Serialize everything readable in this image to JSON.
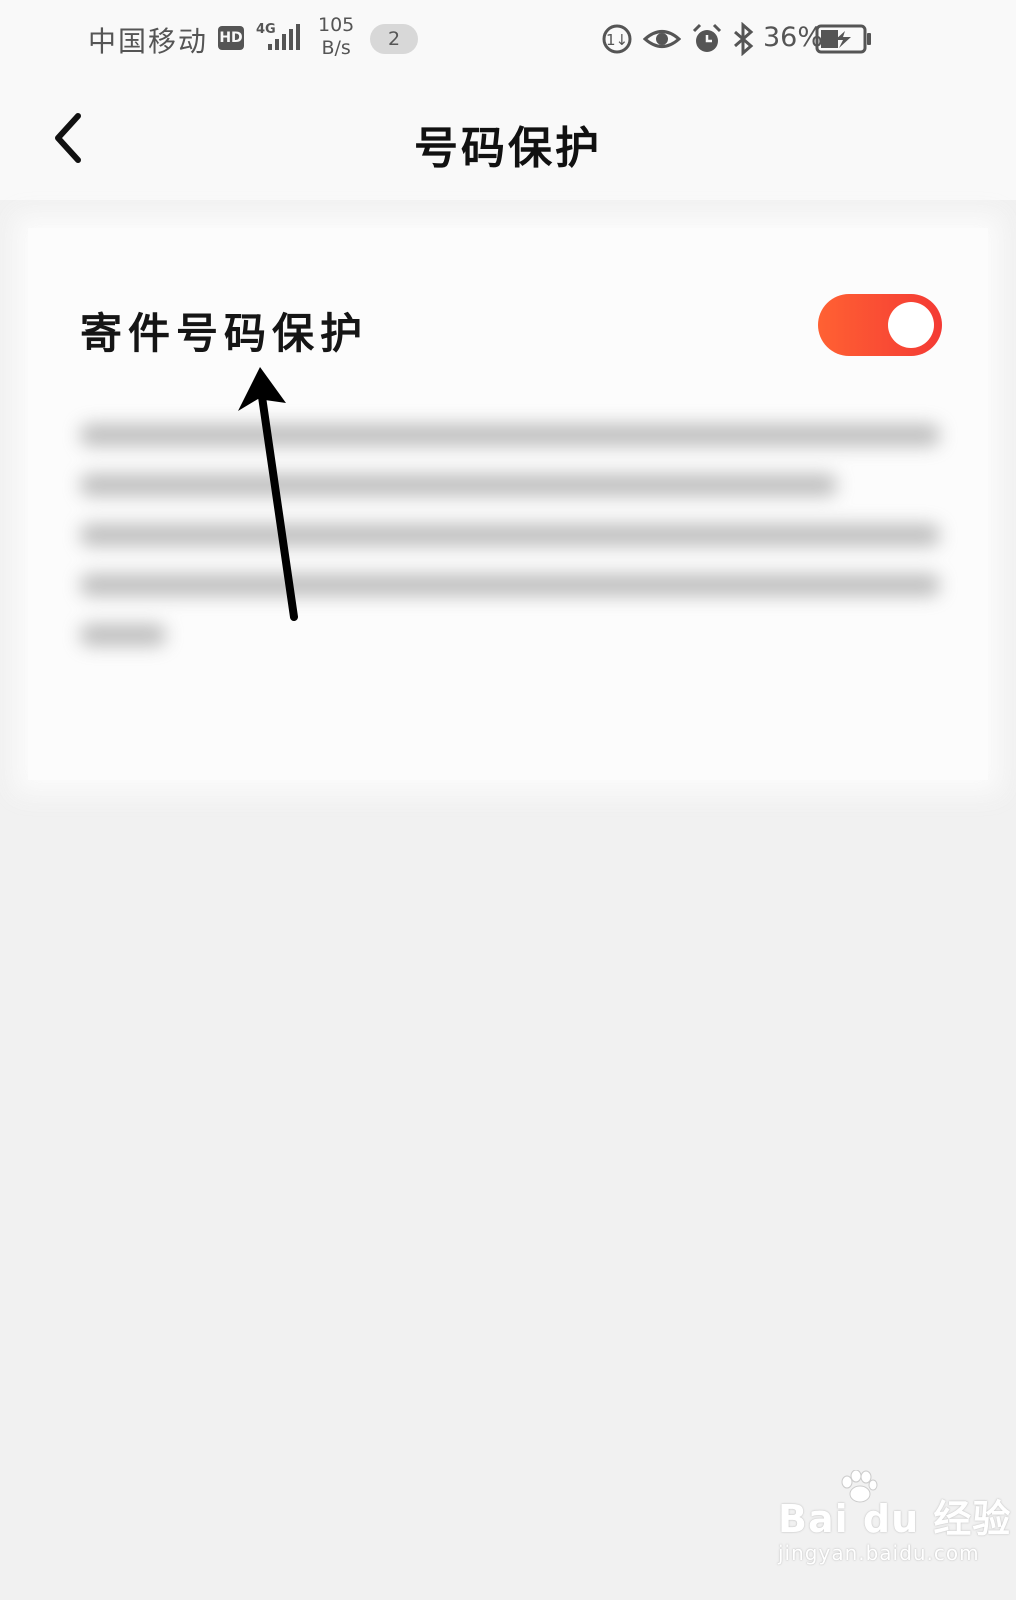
{
  "status_bar": {
    "carrier": "中国移动",
    "hd_badge": "HD",
    "network": "4G",
    "speed_value": "105",
    "speed_unit": "B/s",
    "notification_count": "2",
    "battery_percent": "36%",
    "icons": [
      "data-saver-icon",
      "eye-icon",
      "alarm-icon",
      "bluetooth-icon",
      "battery-charging-icon"
    ]
  },
  "header": {
    "title": "号码保护",
    "back_icon": "chevron-left-icon"
  },
  "setting": {
    "label": "寄件号码保护",
    "toggle_on": true,
    "toggle_color": "#f94d33"
  },
  "annotation": {
    "type": "arrow",
    "color": "#000000"
  },
  "watermark": {
    "main": "Bai du 经验",
    "sub": "jingyan.baidu.com"
  }
}
